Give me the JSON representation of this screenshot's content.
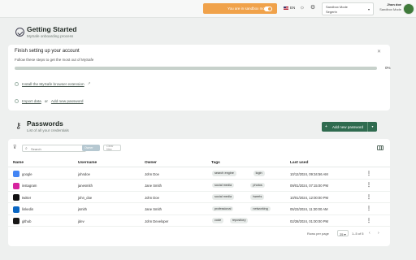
{
  "topbar": {
    "sandbox_notice": "You are in sandbox mode",
    "language": "EN",
    "env_select": {
      "label": "Sandbox Mode",
      "value": "Segerin"
    },
    "user": {
      "name": "Jhon doe",
      "mode": "Sandbox Mode"
    }
  },
  "getting_started": {
    "title": "Getting Started",
    "subtitle": "MySafe onboarding process",
    "card": {
      "title": "Finish setting up your account",
      "subtitle": "Follow these steps to get the most out of MySafe",
      "progress_percent": 0,
      "progress_label": "0%",
      "steps": [
        {
          "label": "Install the MySafe browser extension"
        },
        {
          "label": "Import data",
          "connector": "or",
          "label2": "Add new password"
        }
      ]
    }
  },
  "passwords": {
    "title": "Passwords",
    "subtitle": "List of all your credentials",
    "add_button": "Add new password",
    "search_placeholder": "Search",
    "filter_chip": "Owner",
    "clear_filter": "Clear filter",
    "columns": [
      "Name",
      "Username",
      "Owner",
      "Tags",
      "Last used"
    ],
    "rows": [
      {
        "name": "google",
        "username": "johndoe",
        "owner": "John Doe",
        "tags": [
          "search engine",
          "login"
        ],
        "last_used": "10/12/2024, 09:34:56 AM",
        "logo_color": "#4285f4"
      },
      {
        "name": "instagram",
        "username": "janesmith",
        "owner": "Jane Smith",
        "tags": [
          "social media",
          "photos"
        ],
        "last_used": "09/01/2024, 07:15:00 PM",
        "logo_color": "#d6249f"
      },
      {
        "name": "twitter",
        "username": "john_doe",
        "owner": "John Doe",
        "tags": [
          "social media",
          "tweets"
        ],
        "last_used": "10/01/2024, 12:00:00 PM",
        "logo_color": "#111111"
      },
      {
        "name": "linkedin",
        "username": "jsmith",
        "owner": "Jane Smith",
        "tags": [
          "professional",
          "networking"
        ],
        "last_used": "05/23/2024, 11:30:00 AM",
        "logo_color": "#0a66c2"
      },
      {
        "name": "github",
        "username": "jdev",
        "owner": "John Developer",
        "tags": [
          "code",
          "repository"
        ],
        "last_used": "02/28/2024, 01:00:00 PM",
        "logo_color": "#181717"
      }
    ],
    "pagination": {
      "rows_label": "Rows per page",
      "rows_value": "25",
      "range": "1–5 of 5"
    }
  }
}
